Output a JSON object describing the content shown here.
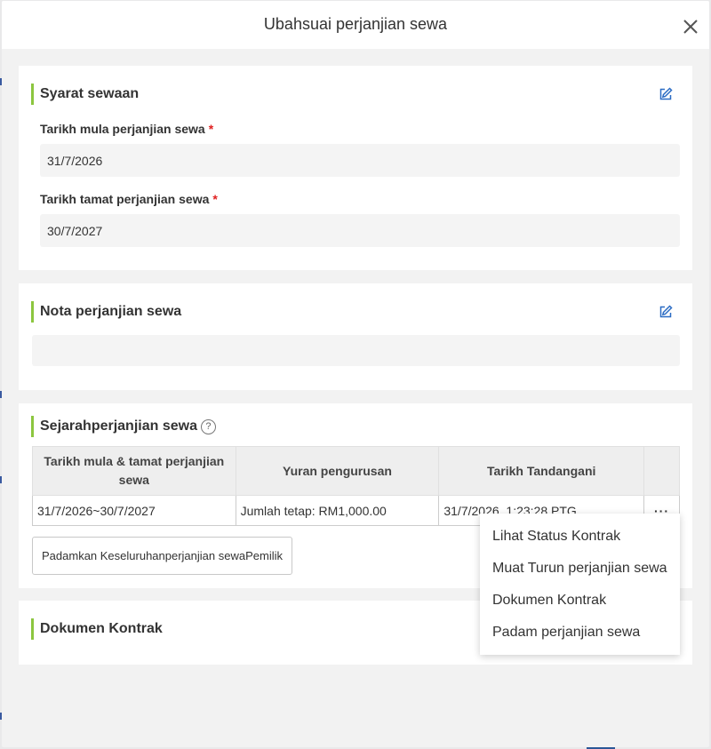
{
  "dialog": {
    "title": "Ubahsuai perjanjian sewa"
  },
  "lease_terms": {
    "title": "Syarat sewaan",
    "start_label": "Tarikh mula perjanjian sewa",
    "start_value": "31/7/2026",
    "end_label": "Tarikh tamat perjanjian sewa",
    "end_value": "30/7/2027",
    "required_mark": "*"
  },
  "lease_notes": {
    "title": "Nota perjanjian sewa",
    "value": ""
  },
  "history": {
    "title": "Sejarahperjanjian sewa",
    "help_glyph": "?",
    "columns": [
      "Tarikh mula & tamat perjanjian sewa",
      "Yuran pengurusan",
      "Tarikh Tandangani",
      ""
    ],
    "rows": [
      {
        "period": "31/7/2026~30/7/2027",
        "fee": "Jumlah tetap: RM1,000.00",
        "signed": "31/7/2026, 1:23:28 PTG",
        "more": "···"
      }
    ],
    "delete_all_button": "Padamkan Keseluruhanperjanjian sewaPemilik"
  },
  "contract_docs": {
    "title": "Dokumen Kontrak"
  },
  "row_menu": {
    "items": [
      "Lihat Status Kontrak",
      "Muat Turun perjanjian sewa",
      "Dokumen Kontrak",
      "Padam perjanjian sewa"
    ]
  },
  "colors": {
    "accent_bar": "#8cc63f",
    "edit_icon": "#2b6cc4",
    "required": "#e02020"
  },
  "icons": [
    "close-icon",
    "edit-icon",
    "help-icon"
  ]
}
